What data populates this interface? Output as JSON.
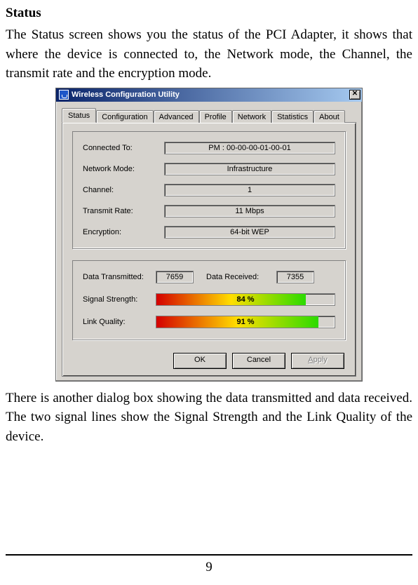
{
  "doc": {
    "heading": "Status",
    "para1": "The Status screen shows you the status of the PCI Adapter, it shows that where the device is connected to, the Network mode, the Channel, the transmit rate and the encryption mode.",
    "para2": "There is another dialog box showing the data transmitted and data received. The two signal lines show the Signal Strength and the Link Quality of the device.",
    "page_number": "9"
  },
  "dialog": {
    "title": "Wireless Configuration Utility",
    "close_glyph": "✕",
    "tabs": [
      "Status",
      "Configuration",
      "Advanced",
      "Profile",
      "Network",
      "Statistics",
      "About"
    ],
    "active_tab": 0,
    "group1": {
      "rows": [
        {
          "label": "Connected To:",
          "value": "PM : 00-00-00-01-00-01"
        },
        {
          "label": "Network Mode:",
          "value": "Infrastructure"
        },
        {
          "label": "Channel:",
          "value": "1"
        },
        {
          "label": "Transmit Rate:",
          "value": "11 Mbps"
        },
        {
          "label": "Encryption:",
          "value": "64-bit WEP"
        }
      ]
    },
    "group2": {
      "data_tx_label": "Data Transmitted:",
      "data_tx_value": "7659",
      "data_rx_label": "Data Received:",
      "data_rx_value": "7355",
      "signal_label": "Signal Strength:",
      "signal_pct": 84,
      "signal_text": "84 %",
      "link_label": "Link Quality:",
      "link_pct": 91,
      "link_text": "91 %"
    },
    "buttons": {
      "ok": "OK",
      "cancel": "Cancel",
      "apply_prefix": "A",
      "apply_rest": "pply"
    }
  }
}
